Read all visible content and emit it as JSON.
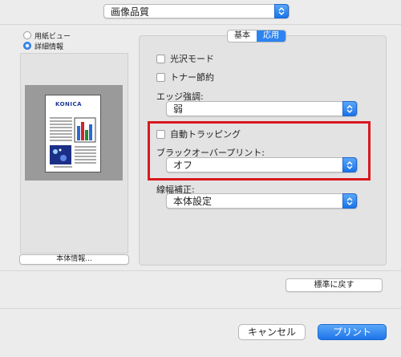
{
  "top_popup": {
    "value": "画像品質"
  },
  "preview_options": [
    {
      "label": "用紙ビュー",
      "selected": false
    },
    {
      "label": "詳細情報",
      "selected": true
    }
  ],
  "preview": {
    "page_heading": "KONICA"
  },
  "machine_info_button": "本体情報...",
  "tabs": [
    {
      "label": "基本",
      "selected": false
    },
    {
      "label": "応用",
      "selected": true
    }
  ],
  "settings": {
    "gloss_mode": {
      "label": "光沢モード",
      "checked": false
    },
    "toner_save": {
      "label": "トナー節約",
      "checked": false
    },
    "edge_enhance": {
      "label": "エッジ強調:",
      "value": "弱"
    },
    "auto_trapping": {
      "label": "自動トラッピング",
      "checked": false
    },
    "black_overprint": {
      "label": "ブラックオーバープリント:",
      "value": "オフ"
    },
    "line_width": {
      "label": "線幅補正:",
      "value": "本体設定"
    }
  },
  "restore_defaults_button": "標準に戻す",
  "cancel_button": "キャンセル",
  "print_button": "プリント",
  "colors": {
    "accent": "#2d84f1",
    "highlight": "#d9191e"
  }
}
